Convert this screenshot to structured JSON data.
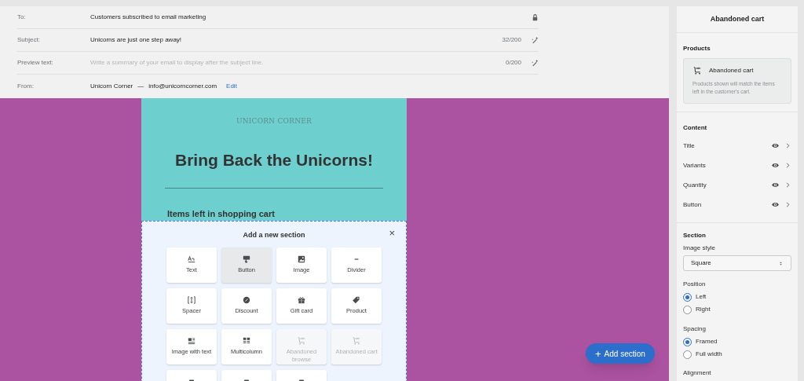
{
  "header": {
    "rows": [
      {
        "label": "To:",
        "value": "Customers subscribed to email marketing",
        "kind": "locked"
      },
      {
        "label": "Subject:",
        "value": "Unicorns are just one step away!",
        "count": "32/200",
        "kind": "magic"
      },
      {
        "label": "Preview text:",
        "placeholder": "Write a summary of your email to display after the subject line.",
        "count": "0/200",
        "kind": "magic"
      },
      {
        "label": "From:",
        "value": "Unicorn Corner",
        "separator": "—",
        "email": "info@unicorncorner.com",
        "link": "Edit",
        "kind": "sender"
      }
    ]
  },
  "email": {
    "brand": "UNICORN CORNER",
    "headline": "Bring Back the Unicorns!",
    "section_heading": "Items left in shopping cart"
  },
  "picker": {
    "title": "Add a new section",
    "close": "×",
    "tiles": [
      {
        "label": "Text",
        "kind": "text",
        "selected": false,
        "disabled": false
      },
      {
        "label": "Button",
        "kind": "button",
        "selected": true,
        "disabled": false
      },
      {
        "label": "Image",
        "kind": "image",
        "selected": false,
        "disabled": false
      },
      {
        "label": "Divider",
        "kind": "divider",
        "selected": false,
        "disabled": false
      },
      {
        "label": "Spacer",
        "kind": "spacer",
        "selected": false,
        "disabled": false
      },
      {
        "label": "Discount",
        "kind": "discount",
        "selected": false,
        "disabled": false
      },
      {
        "label": "Gift card",
        "kind": "gift",
        "selected": false,
        "disabled": false
      },
      {
        "label": "Product",
        "kind": "product",
        "selected": false,
        "disabled": false
      },
      {
        "label": "Image with text",
        "kind": "imagetext",
        "selected": false,
        "disabled": false
      },
      {
        "label": "Multicolumn",
        "kind": "multicolumn",
        "selected": false,
        "disabled": false
      },
      {
        "label": "Abandoned browse",
        "kind": "cart",
        "selected": false,
        "disabled": true
      },
      {
        "label": "Abandoned cart",
        "kind": "cart",
        "selected": false,
        "disabled": true
      },
      {
        "kind": "cutoff",
        "selected": false,
        "disabled": false
      },
      {
        "kind": "cutoff",
        "selected": false,
        "disabled": false
      },
      {
        "kind": "cutoff",
        "selected": false,
        "disabled": false
      }
    ]
  },
  "add_button": {
    "icon": "+",
    "label": "Add section"
  },
  "sidebar": {
    "title": "Abandoned cart",
    "products": {
      "heading": "Products",
      "card_title": "Abandoned cart",
      "card_text": "Products shown will match the items left in the customer's cart."
    },
    "content": {
      "heading": "Content",
      "items": [
        {
          "label": "Title",
          "visible": true
        },
        {
          "label": "Variants",
          "visible": true
        },
        {
          "label": "Quantity",
          "visible": true
        },
        {
          "label": "Button",
          "visible": true
        }
      ]
    },
    "section": {
      "heading": "Section",
      "image_style": {
        "label": "Image style",
        "value": "Square"
      },
      "groups": [
        {
          "label": "Position",
          "options": [
            {
              "label": "Left",
              "selected": true
            },
            {
              "label": "Right",
              "selected": false
            }
          ]
        },
        {
          "label": "Spacing",
          "options": [
            {
              "label": "Framed",
              "selected": true
            },
            {
              "label": "Full width",
              "selected": false
            }
          ]
        }
      ],
      "next_label": "Alignment"
    }
  }
}
